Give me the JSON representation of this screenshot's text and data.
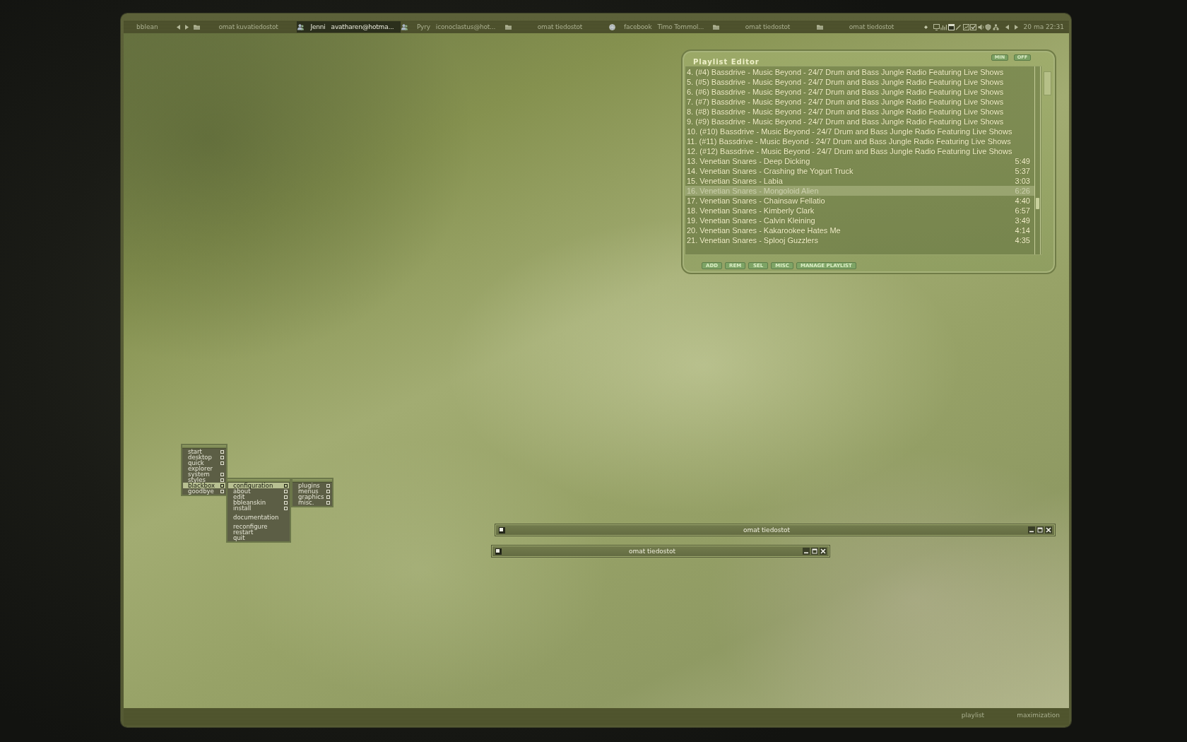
{
  "taskbar": {
    "workspace": "bblean",
    "tasks": [
      {
        "kind": "explorer",
        "label": "omat kuvatiedostot",
        "selected": false
      },
      {
        "kind": "messenger",
        "label": "Jenni   avatharen@hotma...",
        "selected": true
      },
      {
        "kind": "messenger",
        "label": "Pyry   iconoclastus@hot...",
        "selected": false
      },
      {
        "kind": "explorer",
        "label": "omat tiedostot",
        "selected": false
      },
      {
        "kind": "browser",
        "label": "facebook   Timo Tommol...",
        "selected": false
      },
      {
        "kind": "explorer",
        "label": "omat tiedostot",
        "selected": false
      },
      {
        "kind": "explorer",
        "label": "omat tiedostot",
        "selected": false
      }
    ],
    "clock": "20 ma 22:31"
  },
  "playlist_editor": {
    "title": "Playlist Editor",
    "window_buttons": [
      "MIN",
      "OFF"
    ],
    "tracks": [
      {
        "title": "4. (#4) Bassdrive - Music Beyond - 24/7 Drum and Bass Jungle Radio Featuring Live Shows",
        "selected": false
      },
      {
        "title": "5. (#5) Bassdrive - Music Beyond - 24/7 Drum and Bass Jungle Radio Featuring Live Shows",
        "selected": false
      },
      {
        "title": "6. (#6) Bassdrive - Music Beyond - 24/7 Drum and Bass Jungle Radio Featuring Live Shows",
        "selected": false
      },
      {
        "title": "7. (#7) Bassdrive - Music Beyond - 24/7 Drum and Bass Jungle Radio Featuring Live Shows",
        "selected": false
      },
      {
        "title": "8. (#8) Bassdrive - Music Beyond - 24/7 Drum and Bass Jungle Radio Featuring Live Shows",
        "selected": false
      },
      {
        "title": "9. (#9) Bassdrive - Music Beyond - 24/7 Drum and Bass Jungle Radio Featuring Live Shows",
        "selected": false
      },
      {
        "title": "10. (#10) Bassdrive - Music Beyond - 24/7 Drum and Bass Jungle Radio Featuring Live Shows",
        "selected": false
      },
      {
        "title": "11. (#11) Bassdrive - Music Beyond - 24/7 Drum and Bass Jungle Radio Featuring Live Shows",
        "selected": false
      },
      {
        "title": "12. (#12) Bassdrive - Music Beyond - 24/7 Drum and Bass Jungle Radio Featuring Live Shows",
        "selected": false
      },
      {
        "title": "13. Venetian Snares - Deep Dicking",
        "duration": "5:49",
        "selected": false
      },
      {
        "title": "14. Venetian Snares - Crashing the Yogurt Truck",
        "duration": "5:37",
        "selected": false
      },
      {
        "title": "15. Venetian Snares - Labia",
        "duration": "3:03",
        "selected": false
      },
      {
        "title": "16. Venetian Snares - Mongoloid Alien",
        "duration": "6:26",
        "selected": true
      },
      {
        "title": "17. Venetian Snares - Chainsaw Fellatio",
        "duration": "4:40",
        "selected": false
      },
      {
        "title": "18. Venetian Snares - Kimberly Clark",
        "duration": "6:57",
        "selected": false
      },
      {
        "title": "19. Venetian Snares - Calvin Kleining",
        "duration": "3:49",
        "selected": false
      },
      {
        "title": "20. Venetian Snares - Kakarookee Hates Me",
        "duration": "4:14",
        "selected": false
      },
      {
        "title": "21. Venetian Snares - Splooj Guzzlers",
        "duration": "4:35",
        "selected": false
      }
    ],
    "buttons": [
      "ADD",
      "REM",
      "SEL",
      "MISC",
      "MANAGE PLAYLIST"
    ]
  },
  "menu": {
    "items": [
      {
        "kind": "item",
        "label": "start",
        "submenu": true,
        "selected": false
      },
      {
        "kind": "item",
        "label": "desktop",
        "submenu": true,
        "selected": false
      },
      {
        "kind": "item",
        "label": "quick",
        "submenu": true,
        "selected": false
      },
      {
        "kind": "item",
        "label": "explorer",
        "submenu": false,
        "selected": false
      },
      {
        "kind": "item",
        "label": "system",
        "submenu": true,
        "selected": false
      },
      {
        "kind": "item",
        "label": "styles",
        "submenu": true,
        "selected": false
      },
      {
        "kind": "item",
        "label": "blackbox",
        "submenu": true,
        "selected": true,
        "children": [
          {
            "kind": "item",
            "label": "configuration",
            "submenu": true,
            "selected": true,
            "children": [
              {
                "kind": "item",
                "label": "plugins",
                "submenu": true,
                "selected": false
              },
              {
                "kind": "item",
                "label": "menus",
                "submenu": true,
                "selected": false
              },
              {
                "kind": "item",
                "label": "graphics",
                "submenu": true,
                "selected": false
              },
              {
                "kind": "item",
                "label": "misc.",
                "submenu": true,
                "selected": false
              }
            ]
          },
          {
            "kind": "item",
            "label": "about",
            "submenu": true,
            "selected": false
          },
          {
            "kind": "item",
            "label": "edit",
            "submenu": true,
            "selected": false
          },
          {
            "kind": "item",
            "label": "bbleanskin",
            "submenu": true,
            "selected": false
          },
          {
            "kind": "item",
            "label": "install",
            "submenu": true,
            "selected": false
          },
          {
            "kind": "separator"
          },
          {
            "kind": "item",
            "label": "documentation",
            "submenu": false,
            "selected": false
          },
          {
            "kind": "separator"
          },
          {
            "kind": "item",
            "label": "reconfigure",
            "submenu": false,
            "selected": false
          },
          {
            "kind": "item",
            "label": "restart",
            "submenu": false,
            "selected": false
          },
          {
            "kind": "item",
            "label": "quit",
            "submenu": false,
            "selected": false
          }
        ]
      },
      {
        "kind": "item",
        "label": "goodbye",
        "submenu": true,
        "selected": false
      }
    ]
  },
  "windows": [
    {
      "title": "omat tiedostot"
    },
    {
      "title": "omat tiedostot"
    }
  ],
  "bottom_bar": {
    "items": [
      "playlist",
      "maximization"
    ]
  }
}
